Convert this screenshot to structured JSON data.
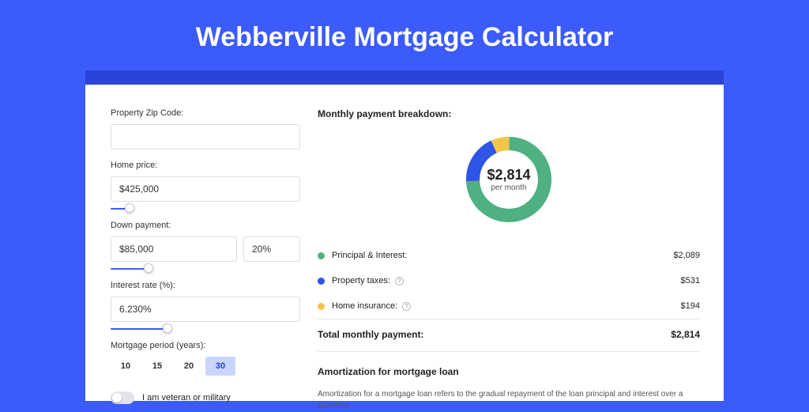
{
  "header": {
    "title": "Webberville Mortgage Calculator"
  },
  "form": {
    "zip_label": "Property Zip Code:",
    "zip_value": "",
    "home_price_label": "Home price:",
    "home_price_value": "$425,000",
    "down_payment_label": "Down payment:",
    "down_payment_value": "$85,000",
    "down_payment_pct": "20%",
    "interest_label": "Interest rate (%):",
    "interest_value": "6.230%",
    "period_label": "Mortgage period (years):",
    "periods": [
      "10",
      "15",
      "20",
      "30"
    ],
    "period_active": "30",
    "veteran_label": "I am veteran or military"
  },
  "breakdown": {
    "header": "Monthly payment breakdown:",
    "amount": "$2,814",
    "sub": "per month",
    "rows": [
      {
        "label": "Principal & Interest:",
        "value": "$2,089",
        "color": "#4fb081",
        "info": false
      },
      {
        "label": "Property taxes:",
        "value": "$531",
        "color": "#2f55e6",
        "info": true
      },
      {
        "label": "Home insurance:",
        "value": "$194",
        "color": "#f3c54b",
        "info": true
      }
    ],
    "total_label": "Total monthly payment:",
    "total_value": "$2,814"
  },
  "amort": {
    "header": "Amortization for mortgage loan",
    "text": "Amortization for a mortgage loan refers to the gradual repayment of the loan principal and interest over a specified"
  },
  "chart_data": {
    "type": "pie",
    "title": "Monthly payment breakdown",
    "series": [
      {
        "name": "Principal & Interest",
        "value": 2089,
        "color": "#4fb081"
      },
      {
        "name": "Property taxes",
        "value": 531,
        "color": "#2f55e6"
      },
      {
        "name": "Home insurance",
        "value": 194,
        "color": "#f3c54b"
      }
    ],
    "total": 2814,
    "center_label": "$2,814 per month"
  }
}
